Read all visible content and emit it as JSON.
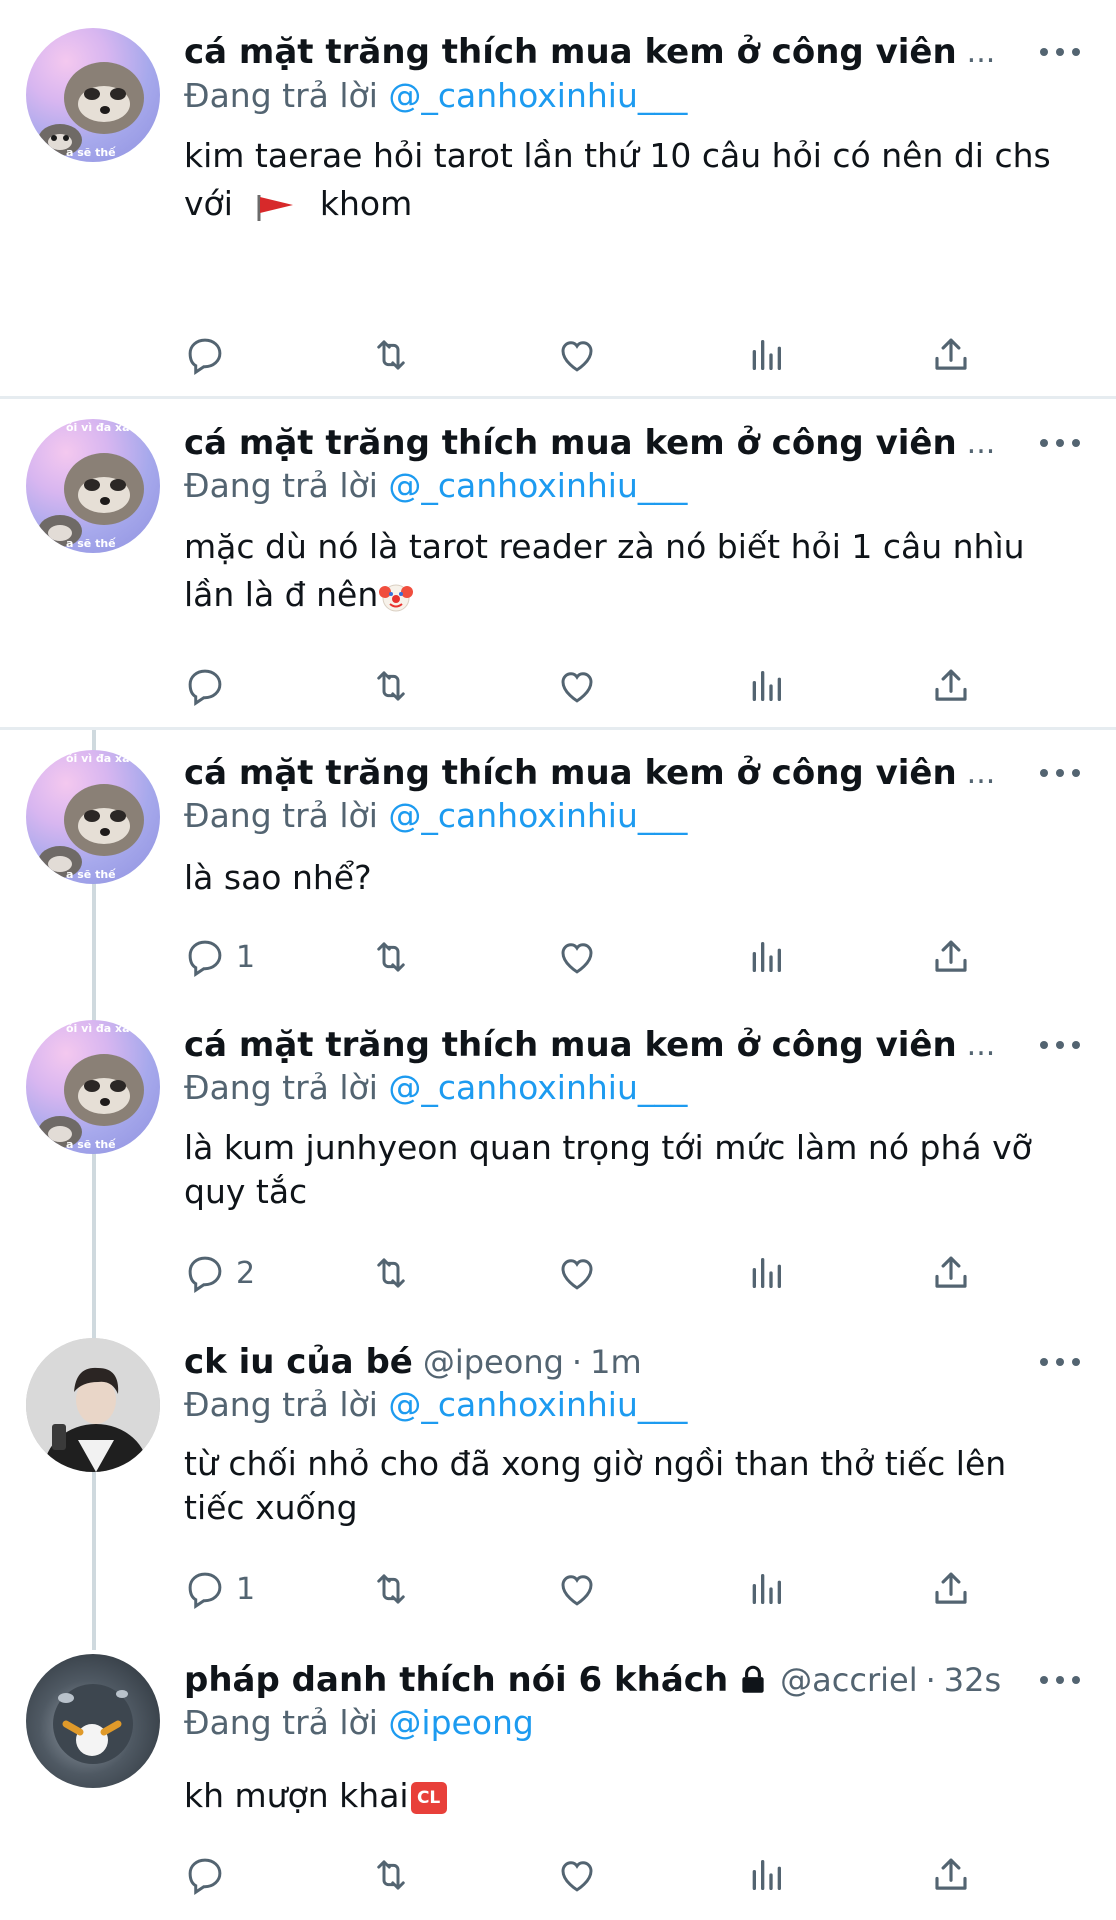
{
  "tweets": [
    {
      "name": "cá mặt trăng thích mua kem ở công viên",
      "ellipsis": "...",
      "reply_prefix": "Đang trả lời",
      "reply_mention": "@_canhoxinhiu___",
      "lines": [
        "kim taerae hỏi tarot lần thứ 10 câu hỏi có nên di chs",
        "với",
        "khom"
      ],
      "reply_count": ""
    },
    {
      "name": "cá mặt trăng thích mua kem ở công viên",
      "ellipsis": "...",
      "reply_prefix": "Đang trả lời",
      "reply_mention": "@_canhoxinhiu___",
      "lines": [
        "mặc dù nó là tarot reader zà nó biết hỏi 1 câu nhìu",
        "lần là đ nên"
      ],
      "reply_count": ""
    },
    {
      "name": "cá mặt trăng thích mua kem ở công viên",
      "ellipsis": "...",
      "reply_prefix": "Đang trả lời",
      "reply_mention": "@_canhoxinhiu___",
      "lines": [
        "là sao nhể?"
      ],
      "reply_count": "1"
    },
    {
      "name": "cá mặt trăng thích mua kem ở công viên",
      "ellipsis": "...",
      "reply_prefix": "Đang trả lời",
      "reply_mention": "@_canhoxinhiu___",
      "lines": [
        "là kum junhyeon quan trọng tới mức làm nó phá vỡ",
        "quy tắc"
      ],
      "reply_count": "2"
    },
    {
      "name": "ck iu của bé",
      "handle": "@ipeong",
      "separator": "·",
      "time": "1m",
      "reply_prefix": "Đang trả lời",
      "reply_mention": "@_canhoxinhiu___",
      "lines": [
        "từ chối nhỏ cho đã xong giờ ngồi than thở tiếc lên",
        "tiếc xuống"
      ],
      "reply_count": "1"
    },
    {
      "name": "pháp danh thích nói 6 khách",
      "handle": "@accriel",
      "separator": "·",
      "time": "32s",
      "reply_prefix": "Đang trả lời",
      "reply_mention": "@ipeong",
      "lines": [
        "kh mượn khai"
      ],
      "reply_count": ""
    }
  ],
  "avatar_caption_top": "ói vì đa xau",
  "avatar_caption_bottom": "a sẽ thế",
  "badge_cl": "CL",
  "colors": {
    "text": "#0f1419",
    "secondary": "#536471",
    "link": "#1d9bf0",
    "divider": "#e6ecf0",
    "thread_line": "#cfd9de"
  },
  "icons": [
    "reply-icon",
    "retweet-icon",
    "like-icon",
    "views-icon",
    "share-icon",
    "more-icon",
    "red-flag-icon",
    "clown-icon",
    "lock-icon",
    "cl-icon"
  ]
}
